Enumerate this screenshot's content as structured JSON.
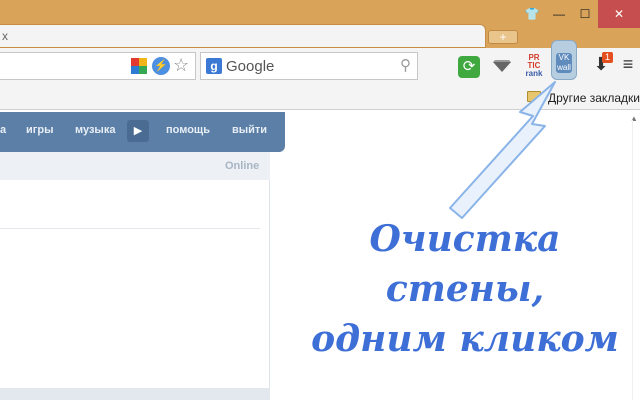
{
  "window": {
    "tab_close": "x",
    "new_tab": "+",
    "controls": {
      "theme": "👕",
      "minimize": "—",
      "maximize": "☐",
      "close": "✕"
    }
  },
  "toolbar": {
    "search": {
      "engine_letter": "g",
      "placeholder": "Google"
    },
    "extensions": {
      "prtic_line1": "PR",
      "prtic_line2": "TIC",
      "prtic_line3": "rank",
      "vk_wall_line1": "VK",
      "vk_wall_line2": "wall",
      "download_badge": "1"
    },
    "menu_glyph": "≡"
  },
  "bookmarks": {
    "other_bookmarks": "Другие закладки"
  },
  "vk": {
    "nav": [
      {
        "label": "а"
      },
      {
        "label": "игры"
      },
      {
        "label": "музыка"
      },
      {
        "label": "помощь"
      },
      {
        "label": "выйти"
      }
    ],
    "more_glyph": "▶",
    "online_label": "Online"
  },
  "overlay": {
    "headline_line1": "Очистка стены,",
    "headline_line2": "одним кликом",
    "arrow_color": "#8ab4e8"
  },
  "colors": {
    "titlebar": "#d9a35a",
    "vk_nav": "#5b7fa6",
    "headline": "#3e6fd6"
  }
}
